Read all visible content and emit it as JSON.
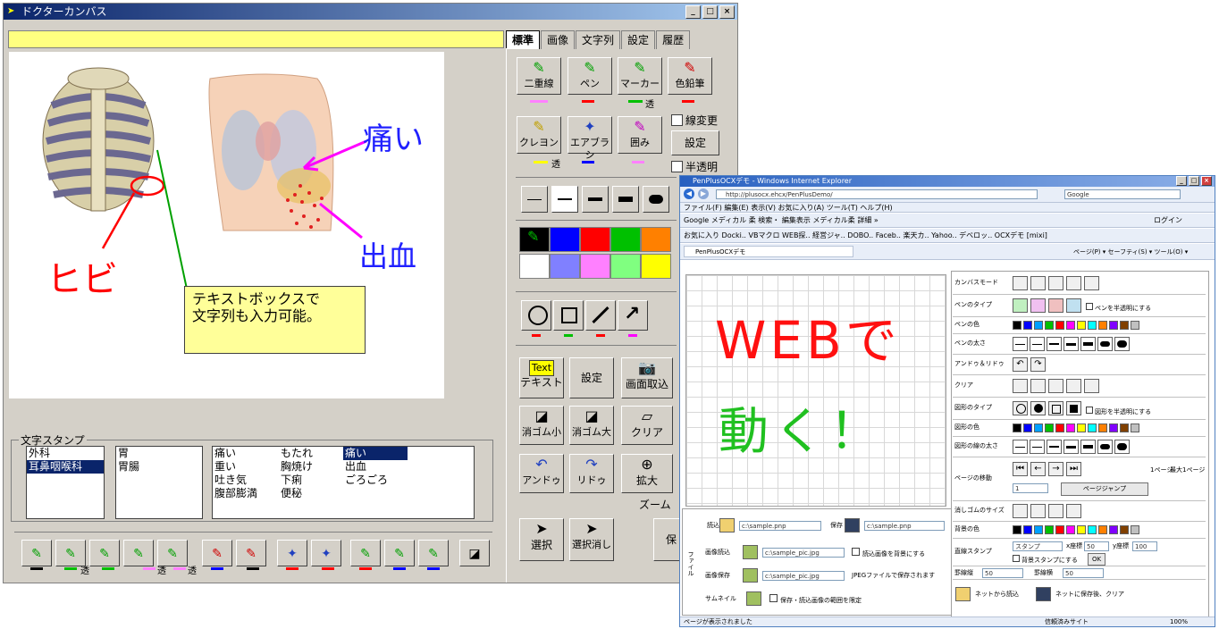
{
  "window1": {
    "title": "ドクターカンバス",
    "tabs": [
      "標準",
      "画像",
      "文字列",
      "設定",
      "履歴"
    ],
    "canvas": {
      "label_pain": "痛い",
      "label_bleeding": "出血",
      "label_crack": "ヒビ",
      "textbox": "テキストボックスで\n文字列も入力可能。"
    },
    "pen_buttons": [
      {
        "label": "二重線",
        "under": "透"
      },
      {
        "label": "ペン",
        "under": ""
      },
      {
        "label": "マーカー",
        "under": "透"
      },
      {
        "label": "色鉛筆",
        "under": ""
      }
    ],
    "pen_buttons_2": [
      {
        "label": "クレヨン",
        "under": "透"
      },
      {
        "label": "エアブラシ",
        "under": ""
      },
      {
        "label": "囲み",
        "under": ""
      }
    ],
    "checkbox_line_change": "線変更",
    "checkbox_translucent": "半透明",
    "settings_button": "設定",
    "tool_buttons": {
      "text_icon": "Text",
      "text": "テキスト",
      "settings": "設定",
      "capture": "画面取込",
      "eraser_small": "消ゴム小",
      "eraser_large": "消ゴム大",
      "clear": "クリア",
      "undo": "アンドゥ",
      "redo": "リドゥ",
      "zoom": "拡大",
      "zoom_label": "ズーム",
      "select": "選択",
      "select_clear": "選択消し",
      "save_partial": "保"
    },
    "stamp": {
      "legend": "文字スタンプ",
      "departments": [
        "外科",
        "耳鼻咽喉科"
      ],
      "organs": [
        "胃",
        "胃腸"
      ],
      "symptoms_col1": [
        "痛い",
        "重い",
        "吐き気",
        "腹部膨満"
      ],
      "symptoms_col2": [
        "もたれ",
        "胸焼け",
        "下痢",
        "便秘"
      ],
      "symptoms_col3": [
        "痛い",
        "出血",
        "ごろごろ"
      ]
    },
    "bottom_pen_labels": [
      "透",
      "透",
      "透"
    ],
    "colors": {
      "palette": [
        "#008000",
        "#0000ff",
        "#ff0000",
        "#00c000",
        "#ff8000",
        "#ffffff",
        "#8080ff",
        "#ff80ff",
        "#80ff80",
        "#ffff00"
      ]
    }
  },
  "window2": {
    "title": "PenPlusOCXデモ - Windows Internet Explorer",
    "address": "http://plusocx.ehcx/PenPlusDemo/",
    "search_placeholder": "Google",
    "menu": "ファイル(F)   編集(E)   表示(V)   お気に入り(A)   ツール(T)   ヘルプ(H)",
    "google_bar": "Google  メディカル 柔   検索・   編集表示   メディカル柔  詳細 »",
    "favorites_bar": "お気に入り   Docki..   VBマクロ   WEB探..   経営ジャ..   DOBO..   Faceb..   楽天カ..   Yahoo..   デベロッ..   OCXデモ   [mixi]",
    "tab_title": "PenPlusOCXデモ",
    "page_tools": "ページ(P) ▾  セーフティ(S) ▾  ツール(O) ▾",
    "login": "ログイン",
    "canvas_text1": "WEBで",
    "canvas_text2": "動く！",
    "rows": [
      "カンバスモード",
      "ペンのタイプ",
      "ペンの色",
      "ペンの太さ",
      "アンドゥ＆リドゥ",
      "クリア",
      "図形のタイプ",
      "図形の色",
      "図形の線の太さ",
      "ページの移動",
      "消しゴムのサイズ",
      "背景の色",
      "直線スタンプ",
      "",
      ""
    ],
    "pen_translucent": "ペンを半透明にする",
    "shape_translucent": "図形を半透明にする",
    "page_label": "1ページ",
    "max_page": "最大1ページ",
    "page_input": "1",
    "page_jump": "ページジャンプ",
    "stamp_value": "スタンプ",
    "x_label": "x座標",
    "x_value": "50",
    "y_label": "y座標",
    "y_value": "100",
    "bg_stamp": "背景スタンプにする",
    "ok": "OK",
    "grid_x_label": "罫線縦",
    "grid_x": "50",
    "grid_y_label": "罫線横",
    "grid_y": "50",
    "net_load": "ネットから読込",
    "net_save": "ネットに保存後、クリア",
    "file_load_label": "読込",
    "file_load": "c:\\sample.pnp",
    "file_save_label": "保存",
    "file_save": "c:\\sample.pnp",
    "image_load_label": "画像読込",
    "image_load": "c:\\sample_pic.jpg",
    "image_bg": "読込画像を背景にする",
    "image_save_label": "画像保存",
    "image_save": "c:\\sample_pic.jpg",
    "jpeg_note": "JPEGファイルで保存されます",
    "thumbnail_label": "サムネイル",
    "thumb_note": "保存・読込画像の範囲を限定",
    "file_group": "ファイル",
    "status_left": "ページが表示されました",
    "status_zone": "信頼済みサイト",
    "status_zoom": "100%",
    "palette": [
      "#000000",
      "#0000ff",
      "#00a0ff",
      "#00c000",
      "#ff0000",
      "#ff00ff",
      "#ffff00",
      "#00ffff",
      "#ff8000",
      "#8000ff",
      "#804000",
      "#c0c0c0"
    ]
  }
}
